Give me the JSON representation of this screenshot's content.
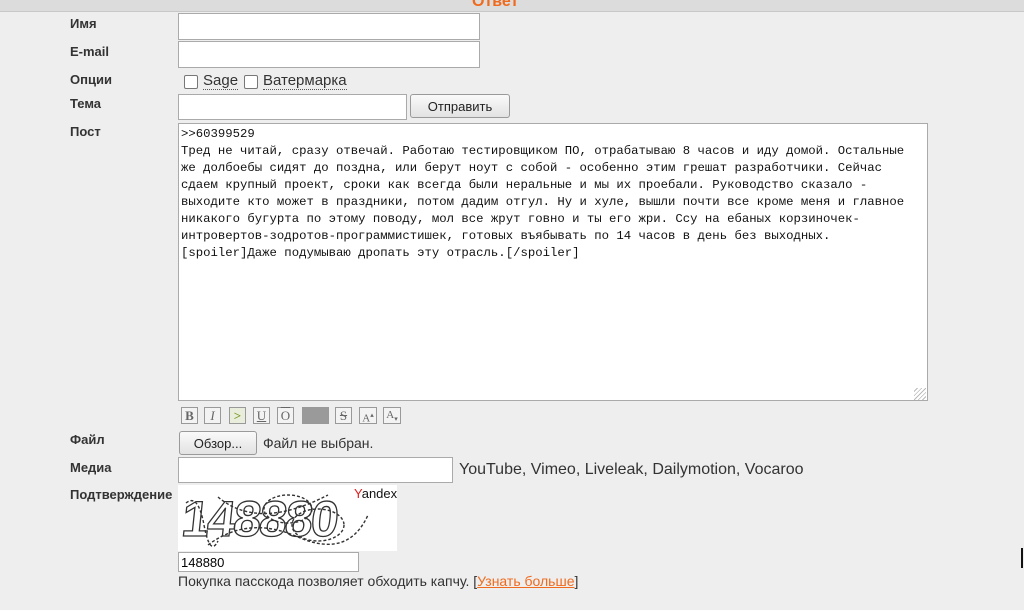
{
  "form": {
    "title": "Ответ",
    "name_label": "Имя",
    "email_label": "E-mail",
    "options_label": "Опции",
    "sage_label": "Sage",
    "watermark_label": "Ватермарка",
    "subject_label": "Тема",
    "submit_label": "Отправить",
    "post_label": "Пост",
    "post_text": ">>60399529\nТред не читай, сразу отвечай. Работаю тестировщиком ПО, отрабатываю 8 часов и иду домой. Остальные же долбоебы сидят до поздна, или берут ноут с собой - особенно этим грешат разработчики. Сейчас сдаем крупный проект, сроки как всегда были неральные и мы их проебали. Руководство сказало - выходите кто может в праздники, потом дадим отгул. Ну и хуле, вышли почти все кроме меня и главное никакого бугурта по этому поводу, мол все жрут говно и ты его жри. Ссу на ебаных корзиночек-интровертов-зодротов-программистишек, готовых въябывать по 14 часов в день без выходных. [spoiler]Даже подумываю дропать эту отрасль.[/spoiler]",
    "file_label": "Файл",
    "browse_label": "Обзор...",
    "file_status": "Файл не выбран.",
    "media_label": "Медиа",
    "media_services": "YouTube, Vimeo, Liveleak, Dailymotion, Vocaroo",
    "captcha_label": "Подтверждение",
    "captcha_image_text": "148880",
    "captcha_brand": "Yandex",
    "captcha_value": "148880",
    "passcode_note_prefix": "Покупка пасскода позволяет обходить капчу. [",
    "passcode_link": "Узнать больше",
    "passcode_note_suffix": "]"
  },
  "toolbar": {
    "bold": "B",
    "italic": "I",
    "quote": ">",
    "underline": "U",
    "overline": "O",
    "spoiler": "",
    "strike": "S",
    "sup": "A",
    "sub": "A"
  },
  "colors": {
    "accent": "#f06a1d",
    "quote_green": "#789922"
  }
}
